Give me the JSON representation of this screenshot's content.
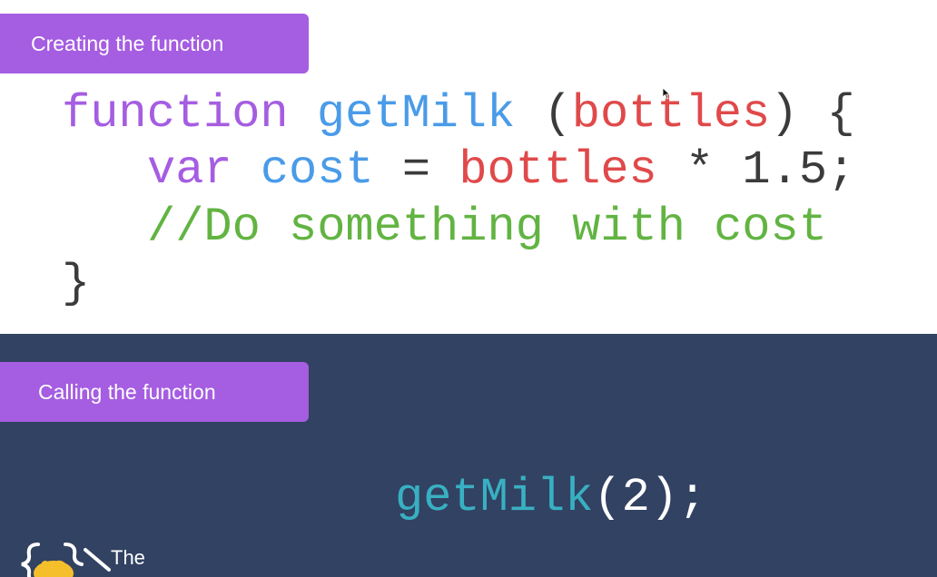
{
  "colors": {
    "top_background": "#ffffff",
    "bottom_background": "#314262",
    "tab_purple": "#a55de1",
    "keyword_purple": "#a55de1",
    "identifier_blue": "#4a9be8",
    "param_red": "#e0494a",
    "comment_green": "#62b442",
    "plain_dark": "#3b3b3b",
    "call_teal": "#39b0c2",
    "call_white": "#ffffff"
  },
  "creating_section": {
    "label": "Creating the function",
    "code": {
      "line1": {
        "keyword": "function",
        "function_name": "getMilk",
        "open_paren": "(",
        "param": "bottles",
        "close_paren": ")",
        "open_brace": "{"
      },
      "line2": {
        "keyword": "var",
        "variable": "cost",
        "operator": "=",
        "param": "bottles",
        "times": "*",
        "number": "1.5;"
      },
      "line3": {
        "comment": "//Do something with cost"
      },
      "line4": {
        "close_brace": "}"
      }
    }
  },
  "calling_section": {
    "label": "Calling the function",
    "call": {
      "function_name": "getMilk",
      "args": "(2);"
    },
    "logo_text": "The"
  }
}
